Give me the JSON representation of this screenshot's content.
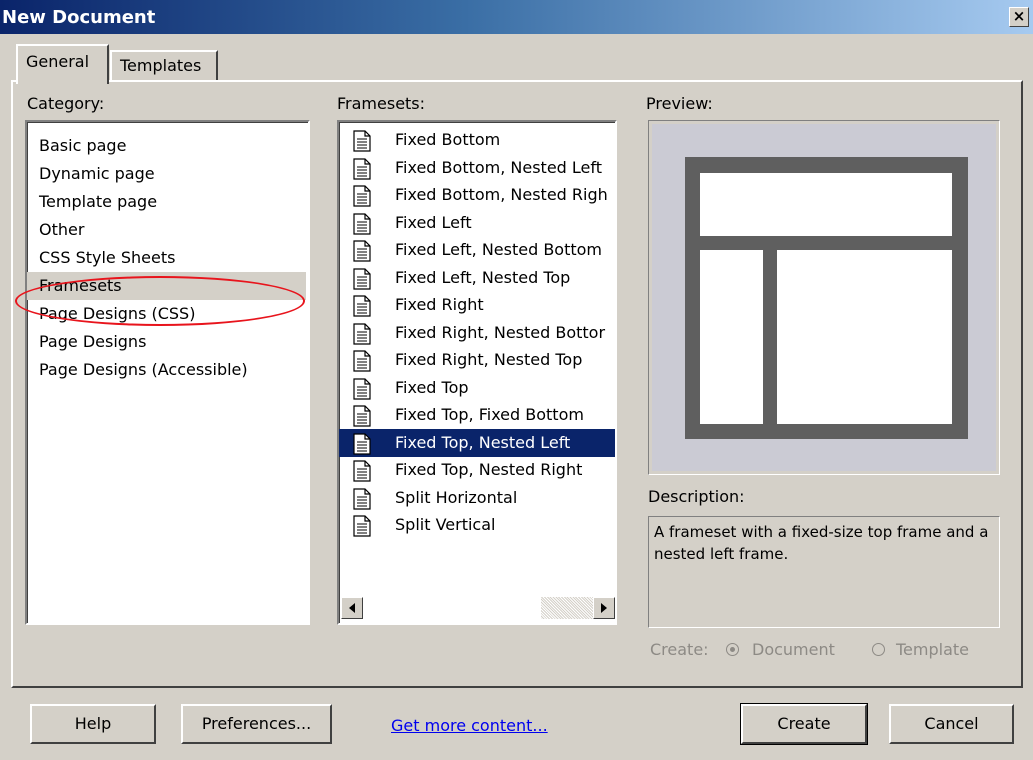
{
  "window": {
    "title": "New Document",
    "close_glyph": "×"
  },
  "tabs": [
    {
      "label": "General",
      "active": true
    },
    {
      "label": "Templates",
      "active": false
    }
  ],
  "category": {
    "label": "Category:",
    "items": [
      {
        "label": "Basic page",
        "selected": false
      },
      {
        "label": "Dynamic page",
        "selected": false
      },
      {
        "label": "Template page",
        "selected": false
      },
      {
        "label": "Other",
        "selected": false
      },
      {
        "label": "CSS Style Sheets",
        "selected": false
      },
      {
        "label": "Framesets",
        "selected": true
      },
      {
        "label": "Page Designs (CSS)",
        "selected": false
      },
      {
        "label": "Page Designs",
        "selected": false
      },
      {
        "label": "Page Designs (Accessible)",
        "selected": false
      }
    ]
  },
  "framesets": {
    "label": "Framesets:",
    "items": [
      {
        "label": "Fixed Bottom",
        "selected": false
      },
      {
        "label": "Fixed Bottom, Nested Left",
        "selected": false
      },
      {
        "label": "Fixed Bottom, Nested Righ",
        "selected": false
      },
      {
        "label": "Fixed Left",
        "selected": false
      },
      {
        "label": "Fixed Left, Nested Bottom",
        "selected": false
      },
      {
        "label": "Fixed Left, Nested Top",
        "selected": false
      },
      {
        "label": "Fixed Right",
        "selected": false
      },
      {
        "label": "Fixed Right, Nested Bottor",
        "selected": false
      },
      {
        "label": "Fixed Right, Nested Top",
        "selected": false
      },
      {
        "label": "Fixed Top",
        "selected": false
      },
      {
        "label": "Fixed Top, Fixed Bottom",
        "selected": false
      },
      {
        "label": "Fixed Top, Nested Left",
        "selected": true
      },
      {
        "label": "Fixed Top, Nested Right",
        "selected": false
      },
      {
        "label": "Split Horizontal",
        "selected": false
      },
      {
        "label": "Split Vertical",
        "selected": false
      }
    ],
    "item_icon": "document-icon"
  },
  "preview": {
    "label": "Preview:"
  },
  "description": {
    "label": "Description:",
    "text": "A frameset with a fixed-size top frame and a nested left frame."
  },
  "create": {
    "label": "Create:",
    "options": [
      {
        "label": "Document",
        "selected": true
      },
      {
        "label": "Template",
        "selected": false
      }
    ],
    "enabled": false
  },
  "buttons": {
    "help": "Help",
    "preferences": "Preferences...",
    "get_more": "Get more content...",
    "create": "Create",
    "cancel": "Cancel"
  },
  "colors": {
    "dialog_bg": "#d4d0c8",
    "selection": "#0a246a",
    "annotation": "#e8141c",
    "preview_frame": "#5f5f5f"
  }
}
